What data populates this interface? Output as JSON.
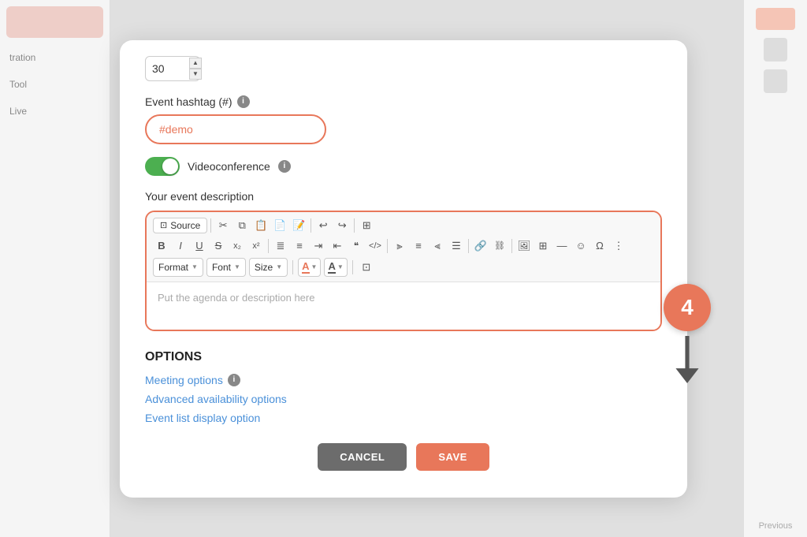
{
  "modal": {
    "number_value": "30",
    "hashtag_label": "Event hashtag (#)",
    "hashtag_placeholder": "#demo",
    "hashtag_value": "#demo",
    "videoconference_label": "Videoconference",
    "videoconference_active": true,
    "description_label": "Your event description",
    "description_placeholder": "Put the agenda or description here",
    "editor": {
      "source_btn": "Source",
      "toolbar_row2": [
        "B",
        "I",
        "U",
        "S",
        "x₂",
        "x²",
        "—",
        "≡",
        "≡",
        "«",
        "»",
        "—",
        "≡",
        "≡",
        "≡",
        "≡",
        "—",
        "🔗",
        "—",
        "🖼",
        "⊞",
        "⊟",
        "☺",
        "Ω",
        "≡"
      ],
      "format_label": "Format",
      "font_label": "Font",
      "size_label": "Size"
    },
    "options": {
      "title": "OPTIONS",
      "meeting_options_label": "Meeting options",
      "advanced_availability_label": "Advanced availability options",
      "event_list_label": "Event list display option"
    },
    "cancel_label": "CANCEL",
    "save_label": "SAVE",
    "step_number": "4"
  },
  "sidebar": {
    "items": [
      {
        "label": "Tool"
      },
      {
        "label": "Live"
      },
      {
        "label": "tration"
      }
    ]
  },
  "colors": {
    "accent": "#e8775a",
    "toggle_on": "#4caf50",
    "link": "#4a90d9",
    "cancel_bg": "#6c6c6c",
    "arrow_fill": "#555"
  }
}
